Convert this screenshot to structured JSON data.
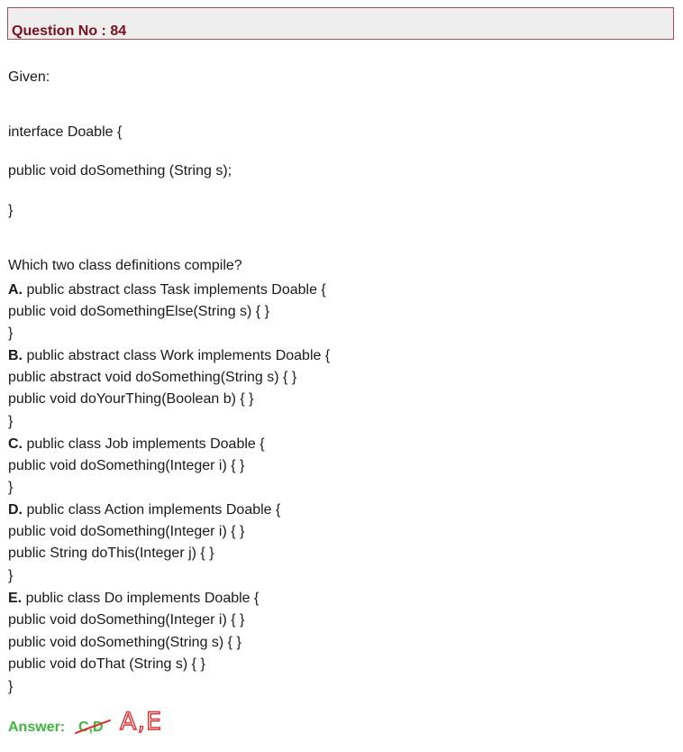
{
  "header": {
    "title": "Question No : 84"
  },
  "question": {
    "given_label": "Given:",
    "code_lines": [
      "interface Doable {",
      "public void doSomething (String s);",
      "}"
    ],
    "prompt": "Which two class definitions compile?"
  },
  "options": [
    {
      "letter": "A.",
      "first_line": " public abstract class Task implements Doable {",
      "lines": [
        "public void doSomethingElse(String s) { }",
        "}"
      ]
    },
    {
      "letter": "B.",
      "first_line": " public abstract class Work implements Doable {",
      "lines": [
        "public abstract void doSomething(String s) { }",
        "public void doYourThing(Boolean b) { }",
        "}"
      ]
    },
    {
      "letter": "C.",
      "first_line": " public class Job implements Doable {",
      "lines": [
        "public void doSomething(Integer i) { }",
        "}"
      ]
    },
    {
      "letter": "D.",
      "first_line": " public class Action implements Doable {",
      "lines": [
        "public void doSomething(Integer i) { }",
        "public String doThis(Integer j) { }",
        "}"
      ]
    },
    {
      "letter": "E.",
      "first_line": " public class Do implements Doable {",
      "lines": [
        "public void doSomething(Integer i) { }",
        "public void doSomething(String s) { }",
        "public void doThat (String s) { }",
        "}"
      ]
    }
  ],
  "answer": {
    "label": "Answer:",
    "original_value": "C,D",
    "corrected_value": "A,E"
  },
  "colors": {
    "header_text": "#7a1020",
    "header_border": "#a0505a",
    "header_background": "#eeeeee",
    "answer_green": "#3fb63f",
    "correction_red": "#e03030"
  }
}
